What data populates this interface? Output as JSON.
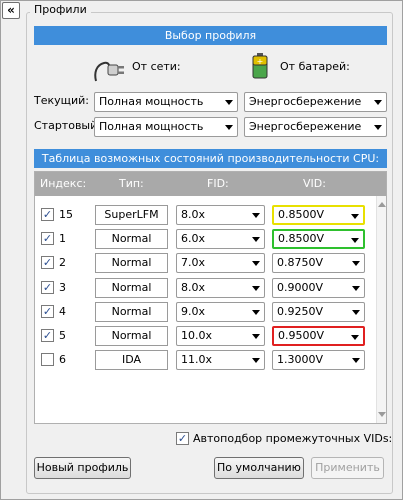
{
  "collapse_glyph": "«",
  "group_title": "Профили",
  "profile_select": {
    "header": "Выбор профиля",
    "ac_label": "От сети:",
    "battery_label": "От батарей:",
    "ac_icon": "power-plug-icon",
    "battery_icon": "battery-icon",
    "current_label": "Текущий:",
    "startup_label": "Стартовый:",
    "current_ac": "Полная мощность",
    "current_battery": "Энергосбережение",
    "startup_ac": "Полная мощность",
    "startup_battery": "Энергосбережение"
  },
  "table": {
    "header": "Таблица возможных состояний производительности CPU:",
    "columns": [
      "Индекс:",
      "Тип:",
      "FID:",
      "VID:"
    ],
    "rows": [
      {
        "checked": true,
        "index": "15",
        "type": "SuperLFM",
        "fid": "8.0x",
        "vid": "0.8500V",
        "highlight": "yellow"
      },
      {
        "checked": true,
        "index": "1",
        "type": "Normal",
        "fid": "6.0x",
        "vid": "0.8500V",
        "highlight": "green"
      },
      {
        "checked": true,
        "index": "2",
        "type": "Normal",
        "fid": "7.0x",
        "vid": "0.8750V",
        "highlight": ""
      },
      {
        "checked": true,
        "index": "3",
        "type": "Normal",
        "fid": "8.0x",
        "vid": "0.9000V",
        "highlight": ""
      },
      {
        "checked": true,
        "index": "4",
        "type": "Normal",
        "fid": "9.0x",
        "vid": "0.9250V",
        "highlight": ""
      },
      {
        "checked": true,
        "index": "5",
        "type": "Normal",
        "fid": "10.0x",
        "vid": "0.9500V",
        "highlight": "red"
      },
      {
        "checked": false,
        "index": "6",
        "type": "IDA",
        "fid": "11.0x",
        "vid": "1.3000V",
        "highlight": ""
      }
    ]
  },
  "auto_vid": {
    "checked": true,
    "label": "Автоподбор промежуточных VIDs:"
  },
  "buttons": {
    "new_profile": "Новый профиль",
    "defaults": "По умолчанию",
    "apply": "Применить"
  },
  "colors": {
    "header_blue": "#3f8edb",
    "table_header_gray": "#a9a9a9",
    "highlight_yellow": "#e8e000",
    "highlight_green": "#2ec02e",
    "highlight_red": "#e02020"
  }
}
